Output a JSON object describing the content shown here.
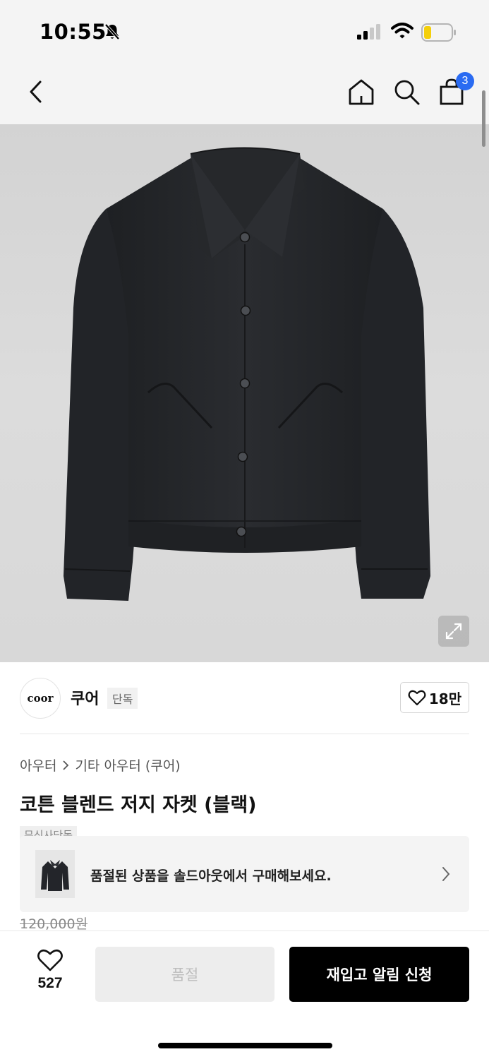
{
  "status_bar": {
    "time": "10:55",
    "icons": [
      "bell-slash-icon",
      "signal-icon",
      "wifi-icon",
      "battery-icon"
    ]
  },
  "nav": {
    "icons": [
      "chevron-left-icon",
      "home-icon",
      "search-icon",
      "shopping-bag-icon"
    ],
    "cart_count": "3"
  },
  "product_image": {
    "expand_icon": "expand-icon"
  },
  "brand": {
    "logo_text": "coor",
    "name": "쿠어",
    "exclusive_tag": "단독",
    "likes": "18만"
  },
  "product": {
    "breadcrumb": [
      "아우터",
      "기타 아우터 (쿠어)"
    ],
    "title": "코튼 블렌드 저지 자켓 (블랙)",
    "partial_label": "무신사단독",
    "original_price": "120,000원"
  },
  "soldout_banner": {
    "text": "품절된 상품을 솔드아웃에서 구매해보세요."
  },
  "bottom_bar": {
    "wish_count": "527",
    "soldout_label": "품절",
    "restock_label": "재입고 알림 신청"
  },
  "colors": {
    "badge": "#2a6bf2",
    "primary_button": "#000000",
    "disabled_button": "#ededed"
  }
}
